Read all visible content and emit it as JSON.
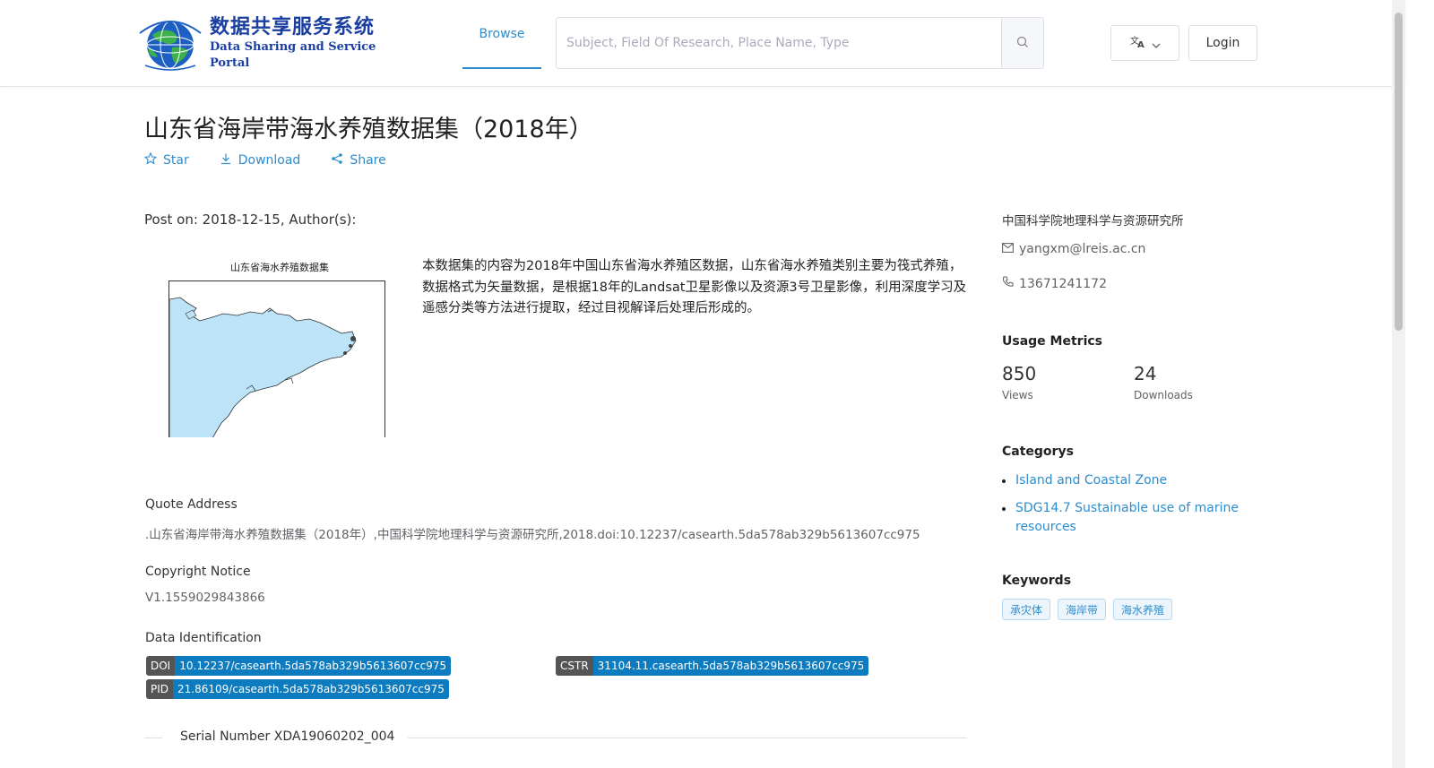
{
  "header": {
    "logo_cn": "数据共享服务系统",
    "logo_en": "Data Sharing and Service Portal",
    "nav_browse": "Browse",
    "search_placeholder": "Subject, Field Of Research, Place Name, Type",
    "login": "Login",
    "lang_icon": "translate-icon"
  },
  "dataset": {
    "title": "山东省海岸带海水养殖数据集（2018年）",
    "actions": {
      "star": "Star",
      "download": "Download",
      "share": "Share"
    },
    "post_on": "Post on: 2018-12-15, Author(s):",
    "thumbnail_title": "山东省海水养殖数据集",
    "description": "本数据集的内容为2018年中国山东省海水养殖区数据，山东省海水养殖类别主要为筏式养殖，数据格式为矢量数据，是根据18年的Landsat卫星影像以及资源3号卫星影像，利用深度学习及遥感分类等方法进行提取，经过目视解译后处理后形成的。",
    "quote_label": "Quote Address",
    "quote_value": ".山东省海岸带海水养殖数据集（2018年）,中国科学院地理科学与资源研究所,2018.doi:10.12237/casearth.5da578ab329b5613607cc975",
    "copyright_label": "Copyright Notice",
    "copyright_value": "V1.1559029843866",
    "identification_label": "Data Identification",
    "identifiers": {
      "doi_key": "DOI",
      "doi_val": "10.12237/casearth.5da578ab329b5613607cc975",
      "cstr_key": "CSTR",
      "cstr_val": "31104.11.casearth.5da578ab329b5613607cc975",
      "pid_key": "PID",
      "pid_val": "21.86109/casearth.5da578ab329b5613607cc975"
    },
    "serial": "Serial Number XDA19060202_004"
  },
  "sidebar": {
    "organization": "中国科学院地理科学与资源研究所",
    "email": "yangxm@lreis.ac.cn",
    "phone": "13671241172",
    "usage_heading": "Usage Metrics",
    "views": "850",
    "views_label": "Views",
    "downloads": "24",
    "downloads_label": "Downloads",
    "categories_heading": "Categorys",
    "categories": [
      "Island and Coastal Zone",
      "SDG14.7 Sustainable use of marine resources"
    ],
    "keywords_heading": "Keywords",
    "keywords": [
      "承灾体",
      "海岸带",
      "海水养殖"
    ]
  },
  "colors": {
    "accent": "#2d8ccd",
    "badge_val": "#0d7bbf",
    "badge_key": "#555555",
    "sea": "#bde3f8"
  }
}
